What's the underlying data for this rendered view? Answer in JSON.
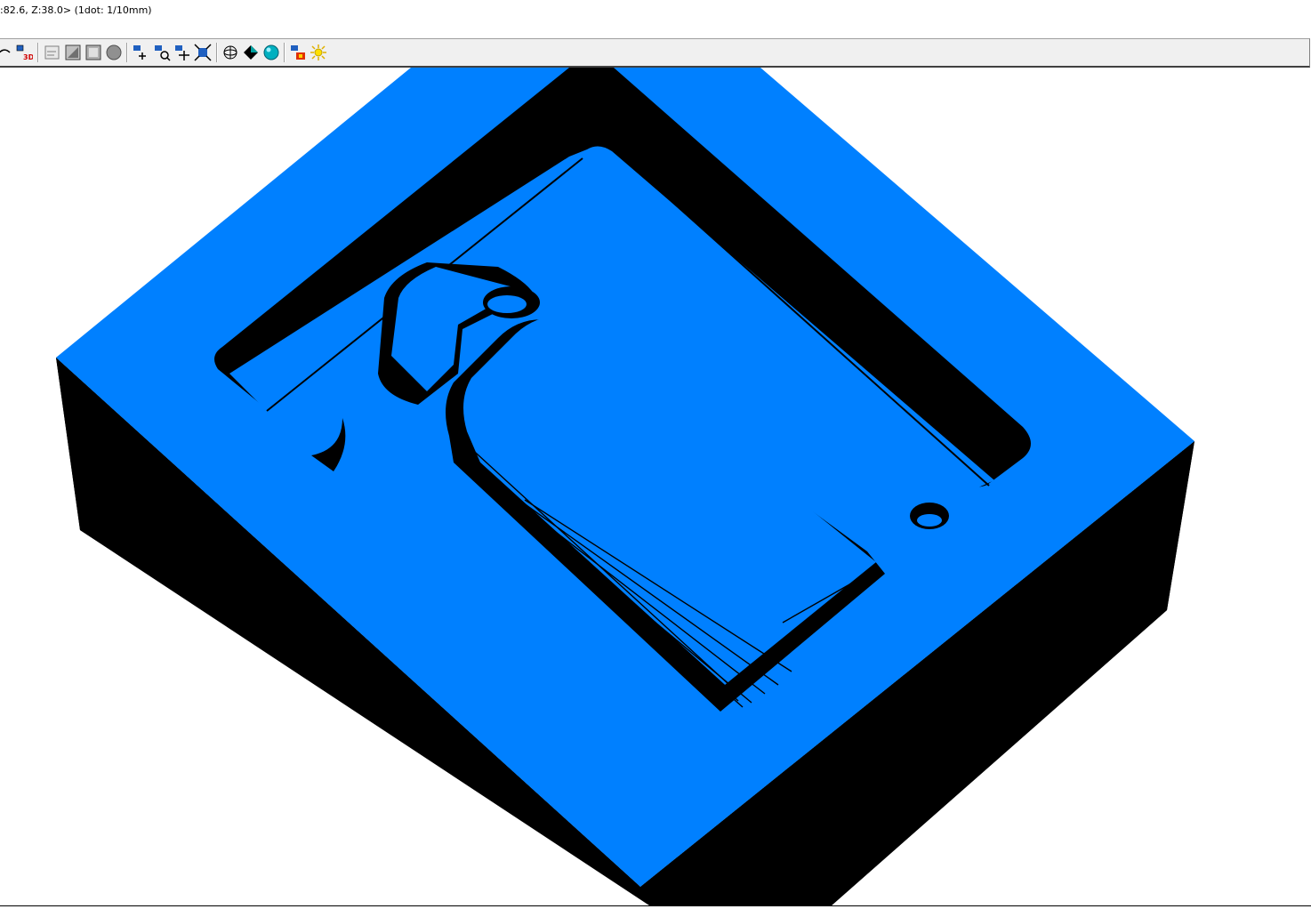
{
  "status": {
    "coords_text": ":82.6, Z:38.0>  (1dot: 1/10mm)"
  },
  "toolbar": {
    "buttons": [
      {
        "name": "curve-tool-icon"
      },
      {
        "name": "view-3d-icon",
        "label": "3D"
      },
      {
        "name": "path-view-icon"
      },
      {
        "name": "slope-view-icon"
      },
      {
        "name": "grid-view-icon"
      },
      {
        "name": "solid-circle-icon"
      },
      {
        "name": "pan-icon"
      },
      {
        "name": "zoom-icon"
      },
      {
        "name": "move-icon"
      },
      {
        "name": "fit-view-icon"
      },
      {
        "name": "wire-sphere-icon"
      },
      {
        "name": "shaded-diamond-icon"
      },
      {
        "name": "shaded-sphere-icon"
      },
      {
        "name": "color-settings-icon"
      },
      {
        "name": "light-icon"
      }
    ]
  },
  "colors": {
    "model_surface": "#0080ff",
    "model_side": "#000000",
    "background": "#ffffff"
  }
}
